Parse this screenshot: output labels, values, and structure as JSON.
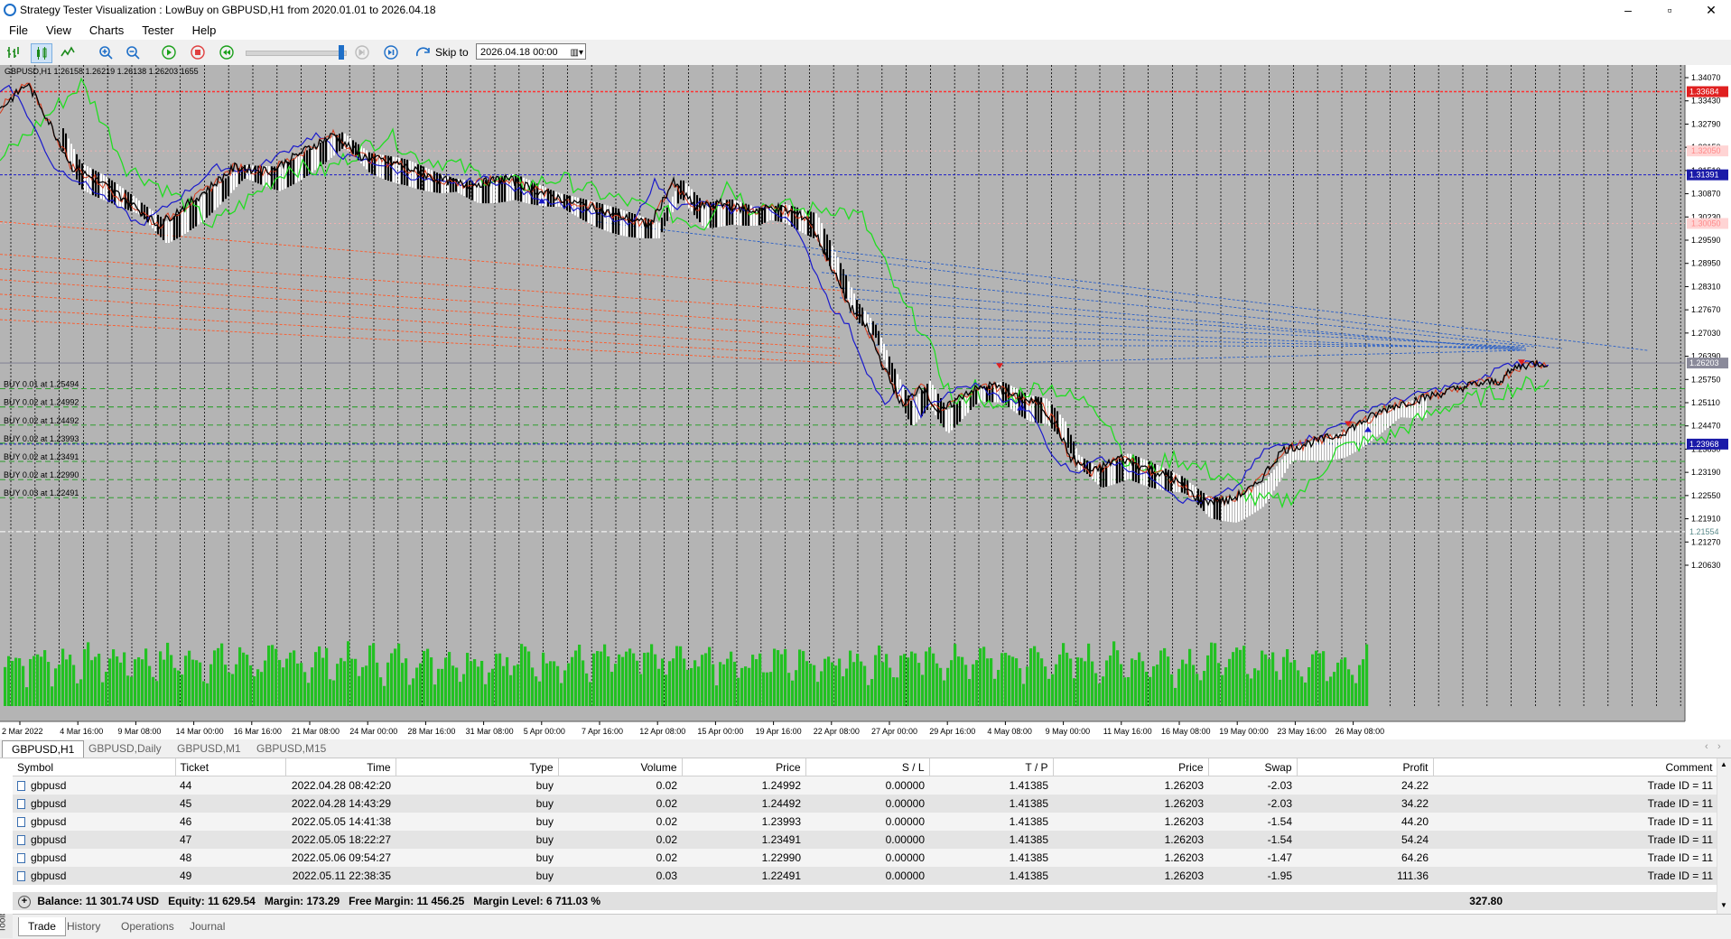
{
  "window": {
    "title": "Strategy Tester Visualization : LowBuy on GBPUSD,H1 from 2020.01.01 to 2026.04.18",
    "controls": [
      "–",
      "▫",
      "✕"
    ]
  },
  "menu": [
    "File",
    "View",
    "Charts",
    "Tester",
    "Help"
  ],
  "toolbar": {
    "skip_label": "Skip to",
    "skip_value": "2026.04.18 00:00",
    "slider_position": 0.98
  },
  "chart": {
    "info": "GBPUSD,H1  1.26158  1.26219  1.26138  1.26203   1655",
    "price_labels": [
      "1.34070",
      "1.33430",
      "1.32790",
      "1.32150",
      "1.31510",
      "1.30870",
      "1.30230",
      "1.29590",
      "1.28950",
      "1.28310",
      "1.27670",
      "1.27030",
      "1.26390",
      "1.25750",
      "1.25110",
      "1.24470",
      "1.23830",
      "1.23190",
      "1.22550",
      "1.21910",
      "1.21270",
      "1.20630"
    ],
    "highlight_prices": [
      {
        "text": "1.33684",
        "bg": "#e02020",
        "fg": "#ffffff"
      },
      {
        "text": "1.31391",
        "bg": "#1a1aa8",
        "fg": "#ffffff"
      },
      {
        "text": "1.26203",
        "bg": "#8a8a9a",
        "fg": "#ffffff"
      },
      {
        "text": "1.23968",
        "bg": "#1a1aa8",
        "fg": "#ffffff"
      },
      {
        "text": "1.21554",
        "bg": "#ffffff",
        "fg": "#5a8a8a"
      }
    ],
    "faint_prices": [
      "1.32050",
      "1.30050"
    ],
    "time_labels": [
      "2 Mar 2022",
      "4 Mar 16:00",
      "9 Mar 08:00",
      "14 Mar 00:00",
      "16 Mar 16:00",
      "21 Mar 08:00",
      "24 Mar 00:00",
      "28 Mar 16:00",
      "31 Mar 08:00",
      "5 Apr 00:00",
      "7 Apr 16:00",
      "12 Apr 08:00",
      "15 Apr 00:00",
      "19 Apr 16:00",
      "22 Apr 08:00",
      "27 Apr 00:00",
      "29 Apr 16:00",
      "4 May 08:00",
      "9 May 00:00",
      "11 May 16:00",
      "16 May 08:00",
      "19 May 00:00",
      "23 May 16:00",
      "26 May 08:00"
    ],
    "buy_labels": [
      "BUY 0.01 at 1.25494",
      "BUY 0.02 at 1.24992",
      "BUY 0.02 at 1.24492",
      "BUY 0.02 at 1.23993",
      "BUY 0.02 at 1.23491",
      "BUY 0.02 at 1.22990",
      "BUY 0.03 at 1.22491"
    ],
    "colors": {
      "background": "#b4b4b4",
      "volume": "#22c122",
      "green_line": "#22dd22",
      "blue_line": "#1a1acc",
      "sell_red": "#e04020",
      "level_red": "#ff4040"
    }
  },
  "chart_tabs": [
    "GBPUSD,H1",
    "GBPUSD,Daily",
    "GBPUSD,M1",
    "GBPUSD,M15"
  ],
  "trades": {
    "columns": [
      "Symbol",
      "Ticket",
      "Time",
      "Type",
      "Volume",
      "Price",
      "S / L",
      "T / P",
      "Price",
      "Swap",
      "Profit",
      "Comment"
    ],
    "rows": [
      [
        "gbpusd",
        "44",
        "2022.04.28 08:42:20",
        "buy",
        "0.02",
        "1.24992",
        "0.00000",
        "1.41385",
        "1.26203",
        "-2.03",
        "24.22",
        "Trade ID = 11"
      ],
      [
        "gbpusd",
        "45",
        "2022.04.28 14:43:29",
        "buy",
        "0.02",
        "1.24492",
        "0.00000",
        "1.41385",
        "1.26203",
        "-2.03",
        "34.22",
        "Trade ID = 11"
      ],
      [
        "gbpusd",
        "46",
        "2022.05.05 14:41:38",
        "buy",
        "0.02",
        "1.23993",
        "0.00000",
        "1.41385",
        "1.26203",
        "-1.54",
        "44.20",
        "Trade ID = 11"
      ],
      [
        "gbpusd",
        "47",
        "2022.05.05 18:22:27",
        "buy",
        "0.02",
        "1.23491",
        "0.00000",
        "1.41385",
        "1.26203",
        "-1.54",
        "54.24",
        "Trade ID = 11"
      ],
      [
        "gbpusd",
        "48",
        "2022.05.06 09:54:27",
        "buy",
        "0.02",
        "1.22990",
        "0.00000",
        "1.41385",
        "1.26203",
        "-1.47",
        "64.26",
        "Trade ID = 11"
      ],
      [
        "gbpusd",
        "49",
        "2022.05.11 22:38:35",
        "buy",
        "0.03",
        "1.22491",
        "0.00000",
        "1.41385",
        "1.26203",
        "-1.95",
        "111.36",
        "Trade ID = 11"
      ]
    ],
    "summary": "Balance: 11 301.74 USD   Equity: 11 629.54   Margin: 173.29   Free Margin: 11 456.25   Margin Level: 6 711.03 %",
    "total_profit": "327.80"
  },
  "bottom_tabs": [
    "Trade",
    "History",
    "Operations",
    "Journal"
  ],
  "toolbox_label": "Toolbox"
}
